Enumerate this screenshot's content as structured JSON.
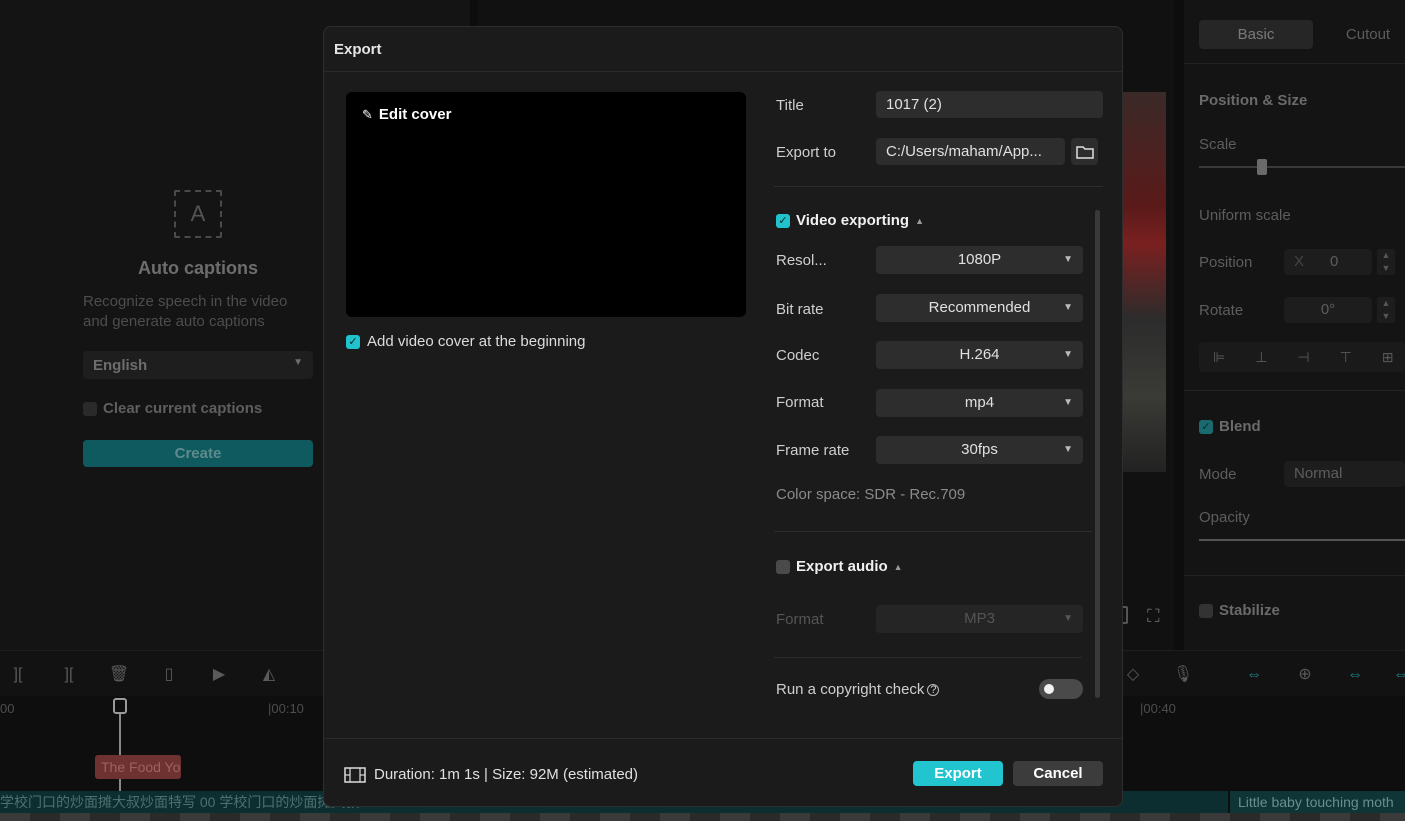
{
  "background": {
    "auto_captions": {
      "title": "Auto captions",
      "description": "Recognize speech in the video and generate auto captions",
      "language": "English",
      "clear_label": "Clear current captions",
      "create_label": "Create"
    },
    "right_panel": {
      "tabs": [
        "Basic",
        "Cutout"
      ],
      "position_size": "Position & Size",
      "scale": "Scale",
      "uniform_scale": "Uniform scale",
      "position": "Position",
      "position_x_label": "X",
      "position_x": "0",
      "rotate": "Rotate",
      "rotate_value": "0°",
      "blend": "Blend",
      "mode": "Mode",
      "mode_value": "Normal",
      "opacity": "Opacity",
      "stabilize": "Stabilize"
    },
    "timeline": {
      "time_start": "00",
      "time_1": "|00:10",
      "time_2": "|00:40",
      "clip_text": "The Food Yo",
      "track_text": "学校门口的炒面摊大叔炒面特写  00  学校门口的炒面摊大叔",
      "track_right": "Little baby touching moth"
    }
  },
  "dialog": {
    "title": "Export",
    "edit_cover": "Edit cover",
    "add_cover_label": "Add video cover at the beginning",
    "title_label": "Title",
    "title_value": "1017 (2)",
    "export_to_label": "Export to",
    "export_to_value": "C:/Users/maham/App...",
    "video_section": "Video exporting",
    "resolution_label": "Resol...",
    "resolution_value": "1080P",
    "bitrate_label": "Bit rate",
    "bitrate_value": "Recommended",
    "codec_label": "Codec",
    "codec_value": "H.264",
    "format_label": "Format",
    "format_value": "mp4",
    "framerate_label": "Frame rate",
    "framerate_value": "30fps",
    "color_space": "Color space: SDR - Rec.709",
    "audio_section": "Export audio",
    "audio_format_label": "Format",
    "audio_format_value": "MP3",
    "copyright_label": "Run a copyright check",
    "footer_info": "Duration: 1m 1s | Size: 92M (estimated)",
    "export_button": "Export",
    "cancel_button": "Cancel"
  },
  "colors": {
    "accent": "#22c4cf",
    "dialog_bg": "#1b1b1b",
    "field_bg": "#2d2d2d"
  }
}
